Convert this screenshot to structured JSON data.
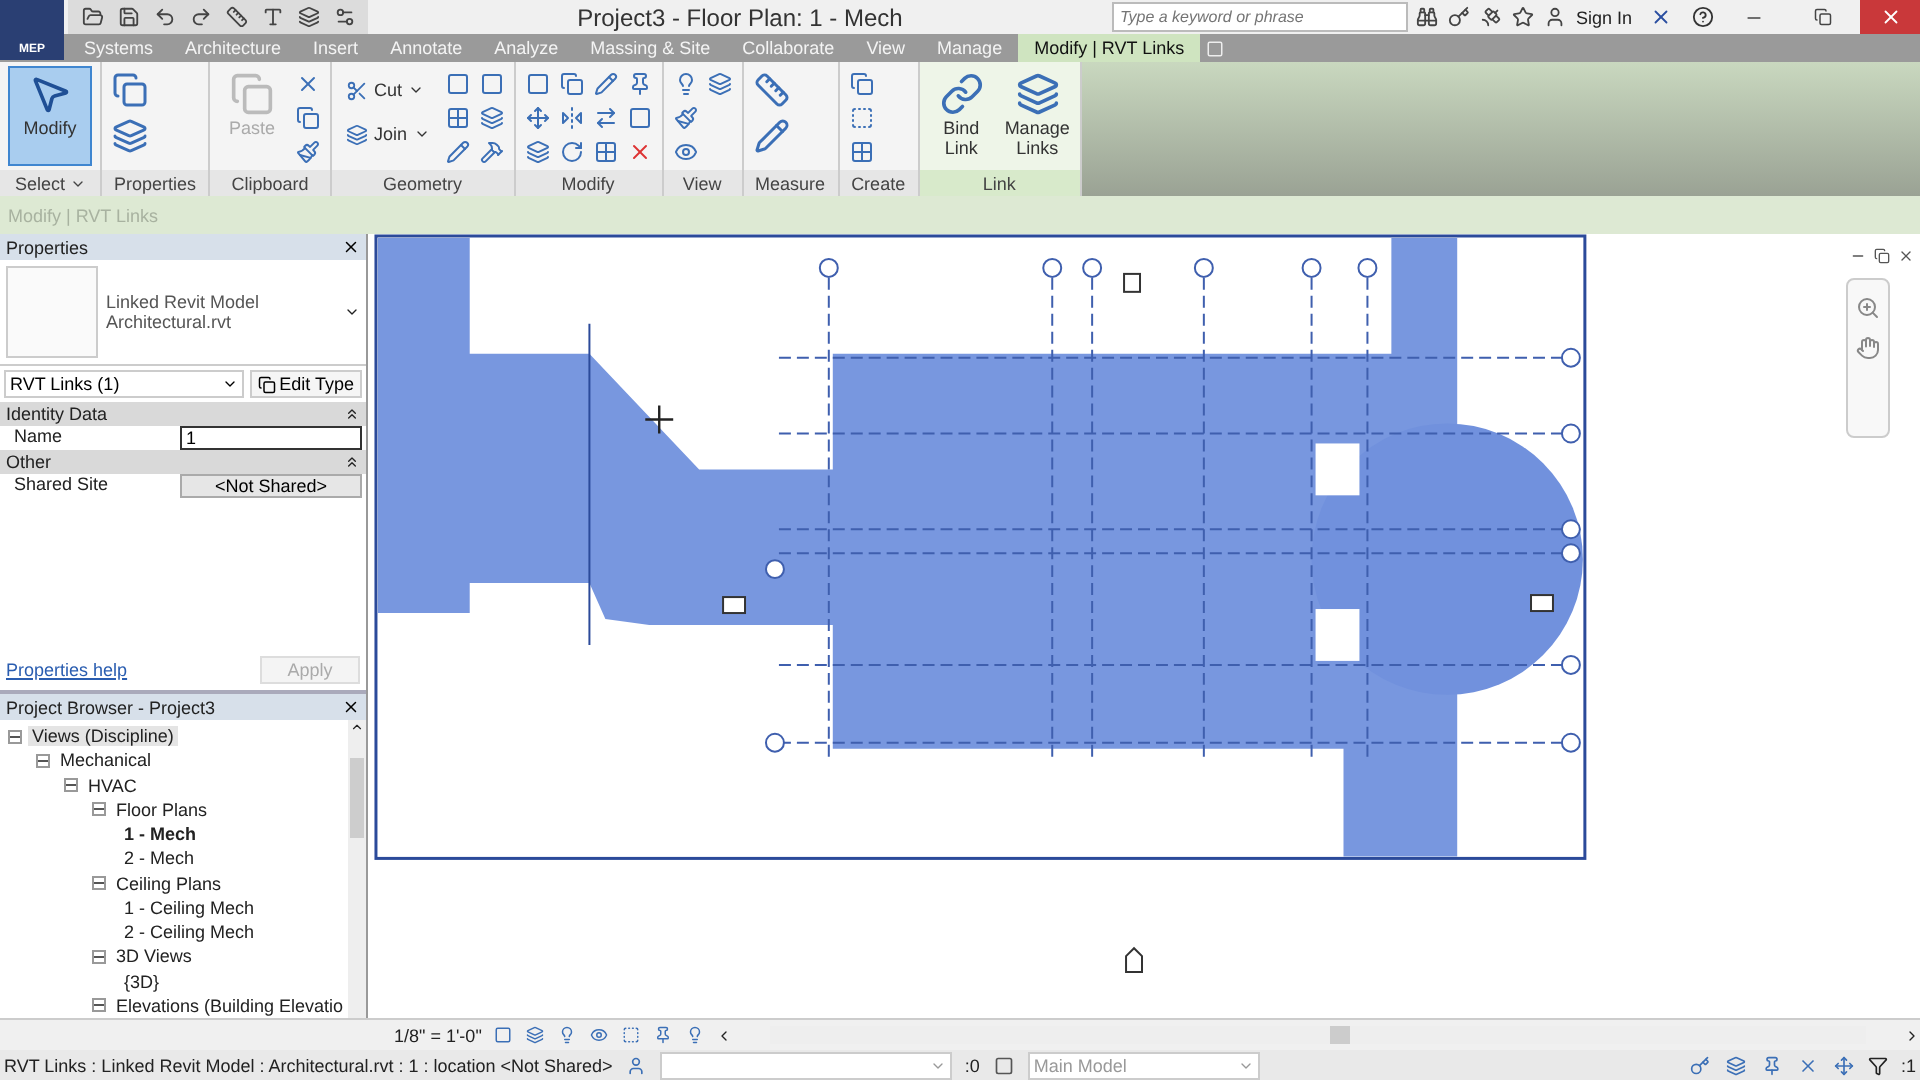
{
  "app_button": {
    "badge": "MEP"
  },
  "title": "Project3 - Floor Plan: 1 - Mech",
  "search": {
    "placeholder": "Type a keyword or phrase"
  },
  "sign_in": "Sign In",
  "tabs": [
    {
      "label": "Systems",
      "selected": false,
      "contextual": false
    },
    {
      "label": "Architecture",
      "selected": false,
      "contextual": false
    },
    {
      "label": "Insert",
      "selected": false,
      "contextual": false
    },
    {
      "label": "Annotate",
      "selected": false,
      "contextual": false
    },
    {
      "label": "Analyze",
      "selected": false,
      "contextual": false
    },
    {
      "label": "Massing & Site",
      "selected": false,
      "contextual": false
    },
    {
      "label": "Collaborate",
      "selected": false,
      "contextual": false
    },
    {
      "label": "View",
      "selected": false,
      "contextual": false
    },
    {
      "label": "Manage",
      "selected": false,
      "contextual": false
    },
    {
      "label": "Modify | RVT Links",
      "selected": true,
      "contextual": true
    }
  ],
  "ribbon": [
    {
      "label": "Select",
      "dropdown": true,
      "contextual": false,
      "buttons": [
        {
          "kind": "large",
          "label": "Modify",
          "selected": true,
          "disabled": false
        }
      ]
    },
    {
      "label": "Properties",
      "dropdown": false,
      "contextual": false
    },
    {
      "label": "Clipboard",
      "dropdown": false,
      "contextual": false,
      "buttons": [
        {
          "kind": "large",
          "label": "Paste",
          "selected": false,
          "disabled": true
        }
      ]
    },
    {
      "label": "Geometry",
      "dropdown": false,
      "contextual": false,
      "buttons": [
        {
          "kind": "small",
          "label": "Cut",
          "selected": false,
          "disabled": false
        },
        {
          "kind": "small",
          "label": "Join",
          "selected": false,
          "disabled": false
        }
      ]
    },
    {
      "label": "Modify",
      "dropdown": false,
      "contextual": false
    },
    {
      "label": "View",
      "dropdown": false,
      "contextual": false
    },
    {
      "label": "Measure",
      "dropdown": false,
      "contextual": false
    },
    {
      "label": "Create",
      "dropdown": false,
      "contextual": false
    },
    {
      "label": "Link",
      "dropdown": false,
      "contextual": true,
      "buttons": [
        {
          "kind": "large",
          "label": "Bind Link",
          "selected": false,
          "disabled": false
        },
        {
          "kind": "large",
          "label": "Manage Links",
          "selected": false,
          "disabled": false
        }
      ]
    }
  ],
  "context_label": "Modify | RVT Links",
  "properties": {
    "title": "Properties",
    "type_name": "Linked Revit Model",
    "type_file": "Architectural.rvt",
    "selector": "RVT Links (1)",
    "edit_type": "Edit Type",
    "groups": [
      {
        "label": "Identity Data",
        "rows": [
          {
            "kind": "input",
            "name": "Name",
            "value": "1"
          }
        ]
      },
      {
        "label": "Other",
        "rows": [
          {
            "kind": "button",
            "name": "Shared Site",
            "value": "<Not Shared>"
          }
        ]
      }
    ],
    "help_link": "Properties help",
    "apply": {
      "label": "Apply",
      "disabled": true
    }
  },
  "browser": {
    "title": "Project Browser - Project3",
    "tree": [
      {
        "label": "Views (Discipline)",
        "selected": true,
        "current": false,
        "expanded": true,
        "children": [
          {
            "label": "Mechanical",
            "selected": false,
            "current": false,
            "expanded": true,
            "children": [
              {
                "label": "HVAC",
                "selected": false,
                "current": false,
                "expanded": true,
                "children": [
                  {
                    "label": "Floor Plans",
                    "selected": false,
                    "current": false,
                    "expanded": true,
                    "children": [
                      {
                        "label": "1 - Mech",
                        "selected": false,
                        "current": true
                      },
                      {
                        "label": "2 - Mech",
                        "selected": false,
                        "current": false
                      }
                    ]
                  },
                  {
                    "label": "Ceiling Plans",
                    "selected": false,
                    "current": false,
                    "expanded": true,
                    "children": [
                      {
                        "label": "1 - Ceiling Mech",
                        "selected": false,
                        "current": false
                      },
                      {
                        "label": "2 - Ceiling Mech",
                        "selected": false,
                        "current": false
                      }
                    ]
                  },
                  {
                    "label": "3D Views",
                    "selected": false,
                    "current": false,
                    "expanded": true,
                    "children": [
                      {
                        "label": "{3D}",
                        "selected": false,
                        "current": false
                      }
                    ]
                  },
                  {
                    "label": "Elevations (Building Elevatio",
                    "selected": false,
                    "current": false,
                    "expanded": true
                  }
                ]
              }
            ]
          }
        ]
      }
    ]
  },
  "view_bar": {
    "scale": "1/8\" = 1'-0\""
  },
  "status_bar": {
    "message": "RVT Links : Linked Revit Model : Architectural.rvt : 1 : location <Not Shared>",
    "worksets": ":0",
    "design_option": "Main Model",
    "filter_count": ":1"
  }
}
